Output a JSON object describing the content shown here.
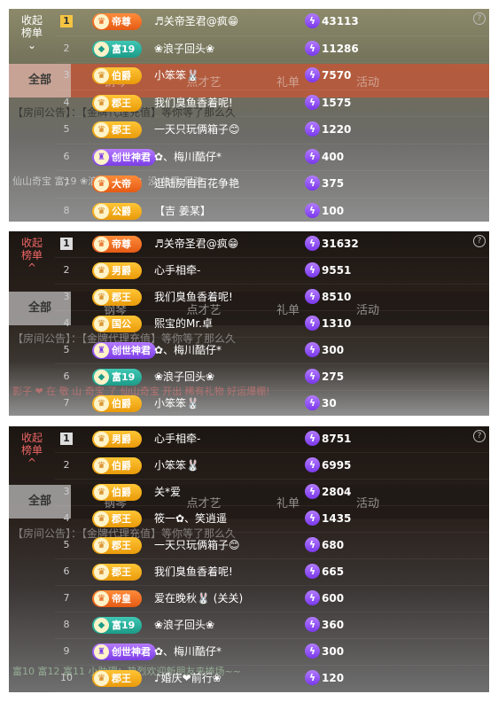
{
  "panels": [
    {
      "collapse_label": "收起\n榜单",
      "collapse_arrow": "⌄",
      "help": "?",
      "background": {
        "tabs": [
          "全部",
          "钢琴",
          "点才艺",
          "礼单",
          "活动"
        ],
        "notice": "【房间公告】：【金牌代理充值】等你等了那么久",
        "chat": "仙山奇宝  富19  ❀浪子回头❀ ：没   伯爵  假装"
      },
      "rows": [
        {
          "rank": "1",
          "badge": "帝尊",
          "badge_style": "orange",
          "name": "♬关帝圣君@疯😁",
          "score": "43113"
        },
        {
          "rank": "2",
          "badge": "富19",
          "badge_style": "teal",
          "name": "❀浪子回头❀",
          "score": "11286"
        },
        {
          "rank": "3",
          "badge": "伯爵",
          "badge_style": "gold",
          "name": "小笨笨🐰",
          "score": "7570"
        },
        {
          "rank": "4",
          "badge": "郡王",
          "badge_style": "gold",
          "name": "我们臭鱼香着呢!",
          "score": "1575"
        },
        {
          "rank": "5",
          "badge": "郡王",
          "badge_style": "gold",
          "name": "一天只玩俩箱子😊",
          "score": "1220"
        },
        {
          "rank": "6",
          "badge": "创世神君",
          "badge_style": "purple",
          "name": "✿、梅川酷仔*",
          "score": "400"
        },
        {
          "rank": "7",
          "badge": "大帝",
          "badge_style": "orange",
          "name": "逛陆房自百花争艳",
          "score": "375"
        },
        {
          "rank": "8",
          "badge": "公爵",
          "badge_style": "gold",
          "name": "【吉 姜某】",
          "score": "100"
        }
      ]
    },
    {
      "collapse_label": "收起\n榜单",
      "collapse_arrow": "^",
      "help": "?",
      "background": {
        "tabs": [
          "全部",
          "钢琴",
          "点才艺",
          "礼单",
          "活动"
        ],
        "notice": "【房间公告】：【金牌代理充值】等你等了那么久",
        "chat": "影子 ❤ 在 敬 山 奇宝 了 仙山奇宝 开出 稀有礼物 好运爆棚!"
      },
      "rows": [
        {
          "rank": "1",
          "badge": "帝尊",
          "badge_style": "orange",
          "name": "♬关帝圣君@疯😁",
          "score": "31632"
        },
        {
          "rank": "2",
          "badge": "男爵",
          "badge_style": "gold",
          "name": "心手相牵-",
          "score": "9551"
        },
        {
          "rank": "3",
          "badge": "郡王",
          "badge_style": "gold",
          "name": "我们臭鱼香着呢!",
          "score": "8510"
        },
        {
          "rank": "4",
          "badge": "国公",
          "badge_style": "gold",
          "name": "熙宝的Mr.卓",
          "score": "1310"
        },
        {
          "rank": "5",
          "badge": "创世神君",
          "badge_style": "purple",
          "name": "✿、梅川酷仔*",
          "score": "300"
        },
        {
          "rank": "6",
          "badge": "富19",
          "badge_style": "teal",
          "name": "❀浪子回头❀",
          "score": "275"
        },
        {
          "rank": "7",
          "badge": "伯爵",
          "badge_style": "gold",
          "name": "小笨笨🐰",
          "score": "30"
        }
      ]
    },
    {
      "collapse_label": "收起\n榜单",
      "collapse_arrow": "^",
      "help": "?",
      "background": {
        "tabs": [
          "全部",
          "钢琴",
          "点才艺",
          "礼单",
          "活动"
        ],
        "notice": "【房间公告】：【金牌代理充值】等你等了那么久",
        "chat": "富10  富12  富11  小助理：热烈欢迎新朋友来捧场~~"
      },
      "rows": [
        {
          "rank": "1",
          "badge": "男爵",
          "badge_style": "gold",
          "name": "心手相牵-",
          "score": "8751"
        },
        {
          "rank": "2",
          "badge": "伯爵",
          "badge_style": "gold",
          "name": "小笨笨🐰",
          "score": "6995"
        },
        {
          "rank": "3",
          "badge": "伯爵",
          "badge_style": "gold",
          "name": "关*爱",
          "score": "2804"
        },
        {
          "rank": "4",
          "badge": "郡王",
          "badge_style": "gold",
          "name": "筱一✿、笑逍遥",
          "score": "1435"
        },
        {
          "rank": "5",
          "badge": "郡王",
          "badge_style": "gold",
          "name": "一天只玩俩箱子😊",
          "score": "680"
        },
        {
          "rank": "6",
          "badge": "郡王",
          "badge_style": "gold",
          "name": "我们臭鱼香着呢!",
          "score": "665"
        },
        {
          "rank": "7",
          "badge": "帝皇",
          "badge_style": "orange",
          "name": "爱在晚秋🐰 (关关)",
          "score": "600"
        },
        {
          "rank": "8",
          "badge": "富19",
          "badge_style": "teal",
          "name": "❀浪子回头❀",
          "score": "360"
        },
        {
          "rank": "9",
          "badge": "创世神君",
          "badge_style": "purple",
          "name": "✿、梅川酷仔*",
          "score": "300"
        },
        {
          "rank": "10",
          "badge": "郡王",
          "badge_style": "gold",
          "name": "♪婚庆❤前行❀",
          "score": "120"
        }
      ]
    }
  ],
  "colors": {
    "score_bolt": "#8a4cf0",
    "rank_first_gold": "#f5c542"
  },
  "icons": {
    "score": "lightning-bolt-icon",
    "help": "help-circle-icon"
  }
}
